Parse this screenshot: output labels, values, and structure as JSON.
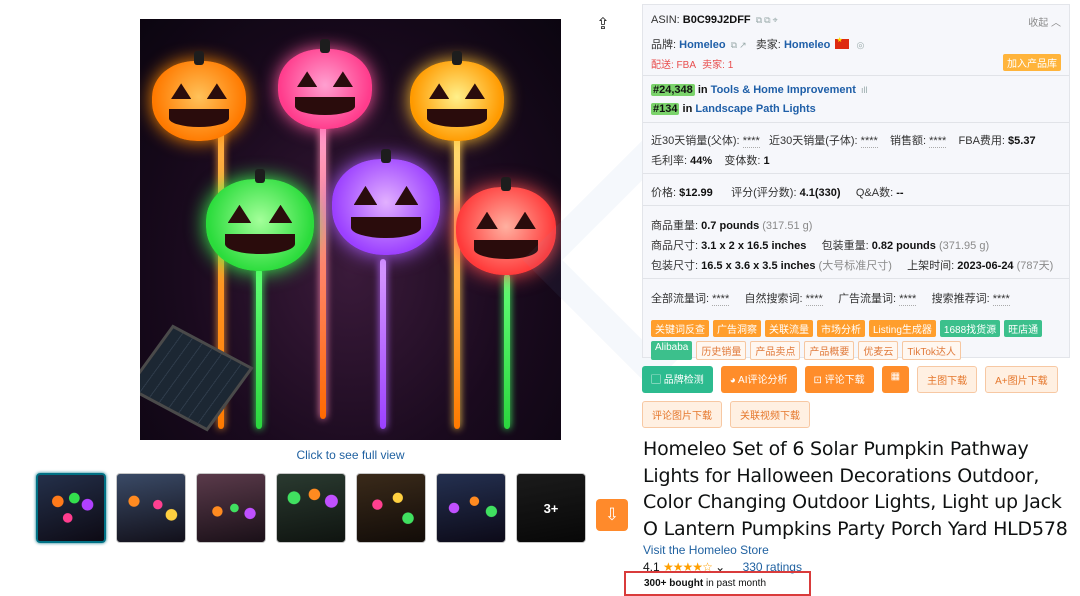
{
  "media": {
    "full_view_label": "Click to see full view",
    "more_thumbs_label": "3+",
    "share_icon": "share-icon",
    "download_icon": "cloud-download-icon"
  },
  "panel": {
    "asin_label": "ASIN:",
    "asin_value": "B0C99J2DFF",
    "collapse_label": "收起",
    "brand_label": "品牌:",
    "brand_value": "Homeleo",
    "seller_label": "卖家:",
    "seller_value": "Homeleo",
    "fulfillment": "配送: FBA",
    "seller_count": "卖家: 1",
    "add_library": "加入产品库",
    "ranks": [
      {
        "rank": "#24,348",
        "in": "in",
        "category": "Tools & Home Improvement"
      },
      {
        "rank": "#134",
        "in": "in",
        "category": "Landscape Path Lights"
      }
    ],
    "sales_parent_label": "近30天销量(父体):",
    "sales_parent_value": "****",
    "sales_child_label": "近30天销量(子体):",
    "sales_child_value": "****",
    "revenue_label": "销售额:",
    "revenue_value": "****",
    "fba_fee_label": "FBA费用:",
    "fba_fee_value": "$5.37",
    "margin_label": "毛利率:",
    "margin_value": "44%",
    "variants_label": "变体数:",
    "variants_value": "1",
    "price_label": "价格:",
    "price_value": "$12.99",
    "score_label": "评分(评分数):",
    "score_value": "4.1(330)",
    "qa_label": "Q&A数:",
    "qa_value": "--",
    "weight_label": "商品重量:",
    "weight_value": "0.7 pounds",
    "weight_g": "(317.51 g)",
    "dims_label": "商品尺寸:",
    "dims_value": "3.1 x 2 x 16.5 inches",
    "pkg_weight_label": "包装重量:",
    "pkg_weight_value": "0.82 pounds",
    "pkg_weight_g": "(371.95 g)",
    "pkg_dims_label": "包装尺寸:",
    "pkg_dims_value": "16.5 x 3.6 x 3.5 inches",
    "pkg_dims_size": "(大号标准尺寸)",
    "listed_label": "上架时间:",
    "listed_value": "2023-06-24",
    "listed_days": "(787天)",
    "traffic_all_label": "全部流量词:",
    "traffic_all_value": "****",
    "traffic_natural_label": "自然搜索词:",
    "traffic_natural_value": "****",
    "traffic_ads_label": "广告流量词:",
    "traffic_ads_value": "****",
    "traffic_rec_label": "搜索推荐词:",
    "traffic_rec_value": "****",
    "chips": [
      {
        "label": "关键词反查",
        "style": "orange"
      },
      {
        "label": "广告洞察",
        "style": "orange"
      },
      {
        "label": "关联流量",
        "style": "orange"
      },
      {
        "label": "市场分析",
        "style": "orange"
      },
      {
        "label": "Listing生成器",
        "style": "orange"
      },
      {
        "label": "1688找货源",
        "style": "green"
      },
      {
        "label": "旺店通",
        "style": "green"
      },
      {
        "label": "Alibaba",
        "style": "green"
      },
      {
        "label": "历史销量",
        "style": "outline"
      },
      {
        "label": "产品卖点",
        "style": "outline"
      },
      {
        "label": "产品概要",
        "style": "outline"
      },
      {
        "label": "优麦云",
        "style": "outline"
      },
      {
        "label": "TikTok达人",
        "style": "outline"
      }
    ]
  },
  "actions": [
    {
      "label": "▢ 品牌检测",
      "style": "teal"
    },
    {
      "label": "◕ AI评论分析",
      "style": "orange"
    },
    {
      "label": "⊡ 评论下载",
      "style": "orange"
    },
    {
      "label": "▦",
      "style": "orange"
    },
    {
      "label": "主图下载",
      "style": "peach"
    },
    {
      "label": "A+图片下载",
      "style": "peach"
    },
    {
      "label": "评论图片下载",
      "style": "peach"
    },
    {
      "label": "关联视频下载",
      "style": "peach"
    }
  ],
  "product": {
    "title": "Homeleo Set of 6 Solar Pumpkin Pathway Lights for Halloween Decorations Outdoor, Color Changing Outdoor Lights, Light up Jack O Lantern Pumpkins Party Porch Yard HLD578",
    "store_link": "Visit the Homeleo Store",
    "rating": "4.1",
    "stars": "★★★★☆",
    "ratings_count": "330 ratings",
    "bought_strong": "300+ bought",
    "bought_rest": " in past month"
  },
  "colors": {
    "accent_teal": "#2dbb8f",
    "accent_orange": "#ff8d2a",
    "link_blue": "#2162a1",
    "highlight_red": "#d93b3b"
  }
}
